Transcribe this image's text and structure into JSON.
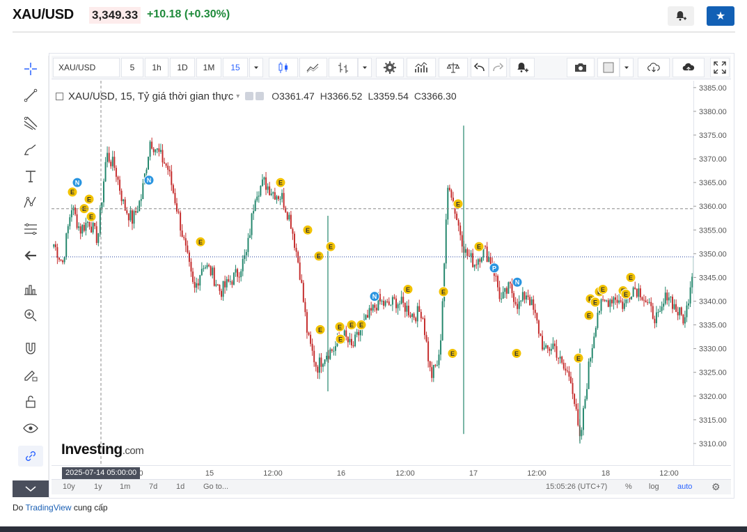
{
  "header": {
    "symbol": "XAU/USD",
    "price": "3,349.33",
    "change": "+10.18",
    "change_pct": "(+0.30%)"
  },
  "toolbar": {
    "symbol_input": "XAU/USD",
    "intervals": [
      "5",
      "1h",
      "1D",
      "1M",
      "15"
    ],
    "active_interval": "15"
  },
  "legend": {
    "title": "XAU/USD, 15, Tỷ giá thời gian thực",
    "open_label": "O",
    "open": "3361.47",
    "high_label": "H",
    "high": "3366.52",
    "low_label": "L",
    "low": "3359.54",
    "close_label": "C",
    "close": "3366.30"
  },
  "chart_data": {
    "type": "candlestick",
    "ylim": [
      3305,
      3386
    ],
    "y_ticks": [
      "3385.00",
      "3380.00",
      "3375.00",
      "3370.00",
      "3365.00",
      "3360.00",
      "3355.00",
      "3350.00",
      "3345.00",
      "3340.00",
      "3335.00",
      "3330.00",
      "3325.00",
      "3320.00",
      "3315.00",
      "3310.00"
    ],
    "x_ticks": [
      ":00",
      "15",
      "12:00",
      "16",
      "12:00",
      "17",
      "12:00",
      "18",
      "12:00"
    ],
    "crosshair_price": "3359.47",
    "last_price": "3349.33",
    "crosshair_date": "2025-07-14 05:00:00",
    "series": [
      {
        "name": "XAU/USD",
        "close_path": [
          3352,
          3348,
          3360,
          3355,
          3357,
          3353,
          3371,
          3368,
          3360,
          3357,
          3362,
          3374,
          3371,
          3368,
          3360,
          3351,
          3342,
          3348,
          3346,
          3342,
          3344,
          3346,
          3350,
          3363,
          3365,
          3363,
          3362,
          3357,
          3347,
          3332,
          3326,
          3329,
          3330,
          3333,
          3330,
          3334,
          3337,
          3340,
          3339,
          3340,
          3339,
          3337,
          3338,
          3324,
          3328,
          3366,
          3357,
          3350,
          3348,
          3351,
          3348,
          3340,
          3343,
          3339,
          3342,
          3336,
          3329,
          3331,
          3326,
          3324,
          3310,
          3326,
          3338,
          3340,
          3341,
          3339,
          3343,
          3342,
          3338,
          3336,
          3342,
          3338,
          3336,
          3349
        ]
      }
    ],
    "event_markers": [
      {
        "letter": "E",
        "price": 3363
      },
      {
        "letter": "E",
        "price": 3361.5
      },
      {
        "letter": "E",
        "price": 3359.5
      },
      {
        "letter": "E",
        "price": 3357.8
      },
      {
        "letter": "N",
        "price": 3365
      },
      {
        "letter": "N",
        "price": 3365.5
      },
      {
        "letter": "E",
        "price": 3365
      },
      {
        "letter": "E",
        "price": 3355
      },
      {
        "letter": "E",
        "price": 3352.5
      },
      {
        "letter": "E",
        "price": 3349.5
      },
      {
        "letter": "E",
        "price": 3351.5
      },
      {
        "letter": "E",
        "price": 3334
      },
      {
        "letter": "E",
        "price": 3334.6
      },
      {
        "letter": "E",
        "price": 3335
      },
      {
        "letter": "E",
        "price": 3332
      },
      {
        "letter": "E",
        "price": 3335
      },
      {
        "letter": "N",
        "price": 3341
      },
      {
        "letter": "E",
        "price": 3342.5
      },
      {
        "letter": "E",
        "price": 3342
      },
      {
        "letter": "E",
        "price": 3329
      },
      {
        "letter": "E",
        "price": 3360.5
      },
      {
        "letter": "E",
        "price": 3351.5
      },
      {
        "letter": "P",
        "price": 3347
      },
      {
        "letter": "N",
        "price": 3344
      },
      {
        "letter": "E",
        "price": 3329
      },
      {
        "letter": "E",
        "price": 3328
      },
      {
        "letter": "E",
        "price": 3337
      },
      {
        "letter": "E",
        "price": 3340.5
      },
      {
        "letter": "E",
        "price": 3339.8
      },
      {
        "letter": "E",
        "price": 3342
      },
      {
        "letter": "E",
        "price": 3342.5
      },
      {
        "letter": "E",
        "price": 3342.2
      },
      {
        "letter": "E",
        "price": 3341.5
      },
      {
        "letter": "E",
        "price": 3345
      }
    ],
    "colors": {
      "up": "#21856b",
      "down": "#c42b2b",
      "marker_e": "#f2c200",
      "marker_n": "#2a95e0"
    }
  },
  "watermark": {
    "brand": "Investing",
    "suffix": ".com"
  },
  "bottom_bar": {
    "ranges": [
      "10y",
      "1y",
      "1m",
      "7d",
      "1d"
    ],
    "goto": "Go to...",
    "time": "15:05:26 (UTC+7)",
    "pct": "%",
    "log": "log",
    "auto": "auto"
  },
  "credit": {
    "prefix": "Do",
    "link": "TradingView",
    "suffix": "cung cấp"
  }
}
